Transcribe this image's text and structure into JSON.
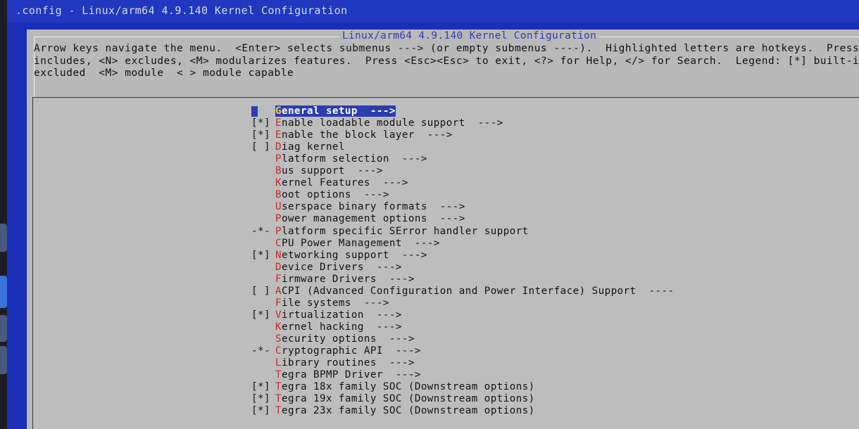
{
  "window": {
    "title": ".config - Linux/arm64 4.9.140 Kernel Configuration"
  },
  "dialog": {
    "title": "Linux/arm64 4.9.140 Kernel Configuration",
    "help_lines": [
      "Arrow keys navigate the menu.  <Enter> selects submenus ---> (or empty submenus ----).  Highlighted letters are hotkeys.  Pressing <Y>",
      "includes, <N> excludes, <M> modularizes features.  Press <Esc><Esc> to exit, <?> for Help, </> for Search.  Legend: [*] built-in  [ ]",
      "excluded  <M> module  < > module capable"
    ]
  },
  "menu": {
    "selected_index": 0,
    "items": [
      {
        "mark": "",
        "hotkey": "G",
        "rest": "eneral setup  --->"
      },
      {
        "mark": "[*]",
        "hotkey": "E",
        "rest": "nable loadable module support  --->"
      },
      {
        "mark": "[*]",
        "hotkey": "E",
        "rest": "nable the block layer  --->"
      },
      {
        "mark": "[ ]",
        "hotkey": "D",
        "rest": "iag kernel"
      },
      {
        "mark": "",
        "hotkey": "P",
        "rest": "latform selection  --->"
      },
      {
        "mark": "",
        "hotkey": "B",
        "rest": "us support  --->"
      },
      {
        "mark": "",
        "hotkey": "K",
        "rest": "ernel Features  --->"
      },
      {
        "mark": "",
        "hotkey": "B",
        "rest": "oot options  --->"
      },
      {
        "mark": "",
        "hotkey": "U",
        "rest": "serspace binary formats  --->"
      },
      {
        "mark": "",
        "hotkey": "P",
        "rest": "ower management options  --->"
      },
      {
        "mark": "-*-",
        "hotkey": "P",
        "rest": "latform specific SError handler support"
      },
      {
        "mark": "",
        "hotkey": "C",
        "rest": "PU Power Management  --->"
      },
      {
        "mark": "[*]",
        "hotkey": "N",
        "rest": "etworking support  --->"
      },
      {
        "mark": "",
        "hotkey": "D",
        "rest": "evice Drivers  --->"
      },
      {
        "mark": "",
        "hotkey": "F",
        "rest": "irmware Drivers  --->"
      },
      {
        "mark": "[ ]",
        "hotkey": "A",
        "rest": "CPI (Advanced Configuration and Power Interface) Support  ----"
      },
      {
        "mark": "",
        "hotkey": "F",
        "rest": "ile systems  --->"
      },
      {
        "mark": "[*]",
        "hotkey": "V",
        "rest": "irtualization  --->"
      },
      {
        "mark": "",
        "hotkey": "K",
        "rest": "ernel hacking  --->"
      },
      {
        "mark": "",
        "hotkey": "S",
        "rest": "ecurity options  --->"
      },
      {
        "mark": "-*-",
        "hotkey": "C",
        "rest": "ryptographic API  --->"
      },
      {
        "mark": "",
        "hotkey": "L",
        "rest": "ibrary routines  --->"
      },
      {
        "mark": "",
        "hotkey": "T",
        "rest": "egra BPMP Driver  --->"
      },
      {
        "mark": "[*]",
        "hotkey": "T",
        "rest": "egra 18x family SOC (Downstream options)"
      },
      {
        "mark": "[*]",
        "hotkey": "T",
        "rest": "egra 19x family SOC (Downstream options)"
      },
      {
        "mark": "[*]",
        "hotkey": "T",
        "rest": "egra 23x family SOC (Downstream options)"
      }
    ]
  },
  "colors": {
    "terminal_blue": "#1a2fb8",
    "dialog_gray": "#b9b9b9",
    "hotkey_red": "#c9262a",
    "selection_blue": "#2a3db3"
  }
}
